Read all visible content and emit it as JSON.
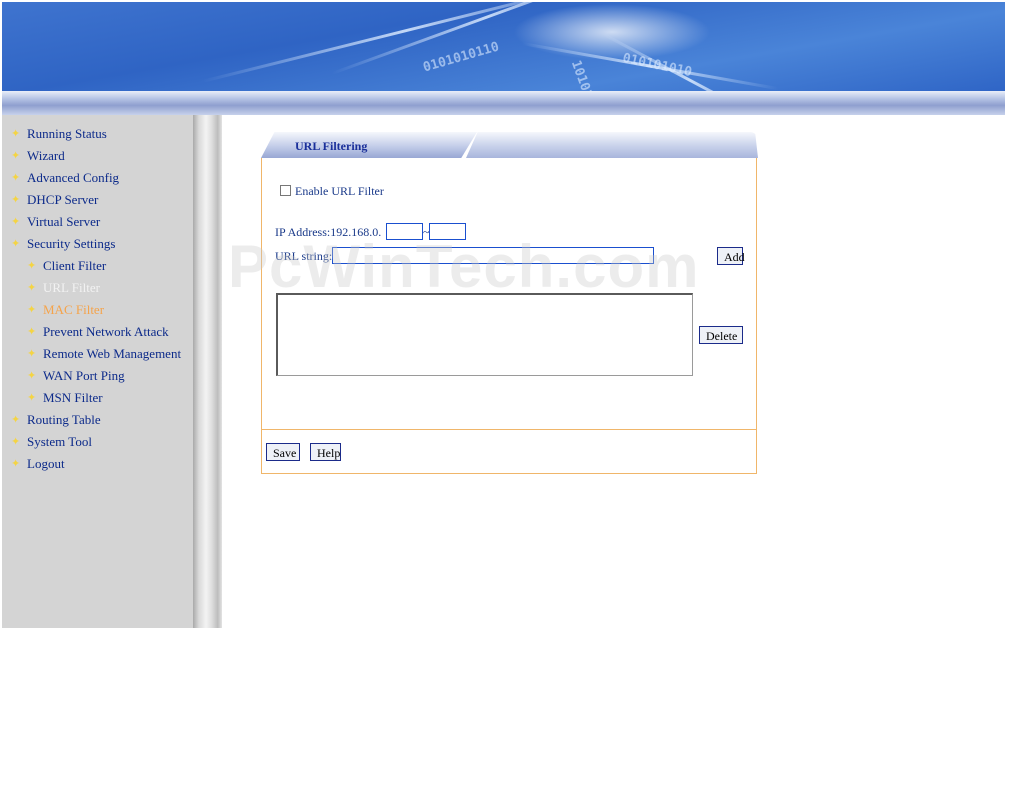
{
  "sidebar": {
    "items": [
      {
        "label": "Running Status",
        "state": "normal"
      },
      {
        "label": "Wizard",
        "state": "normal"
      },
      {
        "label": "Advanced Config",
        "state": "normal"
      },
      {
        "label": "DHCP Server",
        "state": "normal"
      },
      {
        "label": "Virtual Server",
        "state": "normal"
      },
      {
        "label": "Security Settings",
        "state": "normal"
      },
      {
        "label": "Client Filter",
        "state": "sub"
      },
      {
        "label": "URL Filter",
        "state": "sub-current"
      },
      {
        "label": "MAC Filter",
        "state": "sub-hover"
      },
      {
        "label": "Prevent Network Attack",
        "state": "sub"
      },
      {
        "label": "Remote Web Management",
        "state": "sub"
      },
      {
        "label": "WAN Port Ping",
        "state": "sub"
      },
      {
        "label": "MSN Filter",
        "state": "sub"
      },
      {
        "label": "Routing Table",
        "state": "normal"
      },
      {
        "label": "System Tool",
        "state": "normal"
      },
      {
        "label": "Logout",
        "state": "normal"
      }
    ]
  },
  "panel": {
    "title": "URL Filtering",
    "enable_label": "Enable URL Filter",
    "enable_checked": false,
    "ip_label": "IP Address:192.168.0.",
    "ip_separator": "~",
    "ip_start_value": "",
    "ip_end_value": "",
    "url_label": "URL string:",
    "url_value": "",
    "add_label": "Add",
    "delete_label": "Delete",
    "save_label": "Save",
    "help_label": "Help"
  },
  "watermark": "PcWinTech.com",
  "colors": {
    "menu_text": "#0c2a8a",
    "menu_current": "#f2f2f2",
    "menu_hover": "#f5a34a",
    "panel_border": "#f0b66a",
    "banner_blue": "#2f64c4"
  }
}
